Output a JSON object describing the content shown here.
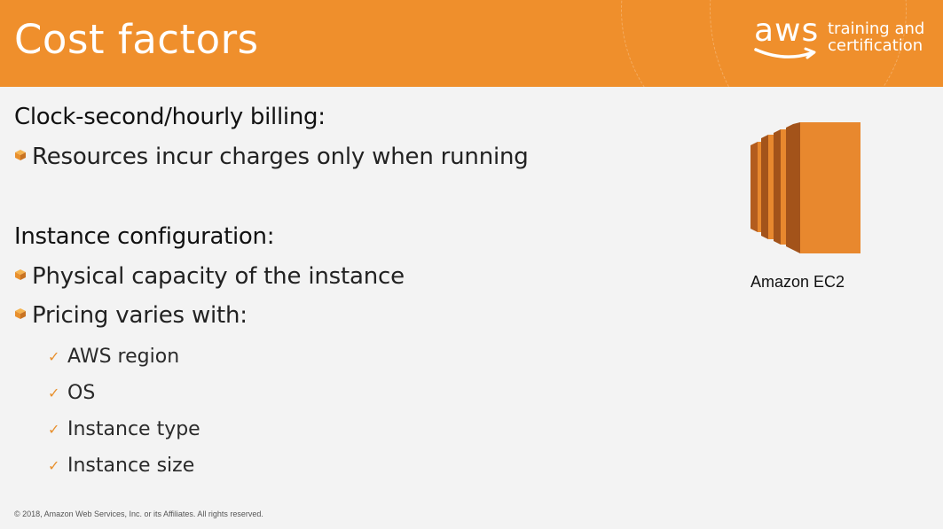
{
  "header": {
    "title": "Cost factors",
    "logo_word": "aws",
    "logo_tagline_1": "training and",
    "logo_tagline_2": "certification"
  },
  "sections": [
    {
      "heading": "Clock-second/hourly billing:",
      "bullets": [
        "Resources incur charges only when running"
      ]
    },
    {
      "heading": "Instance configuration:",
      "bullets": [
        "Physical capacity of the instance",
        "Pricing varies with:"
      ],
      "sub_items": [
        "AWS region",
        "OS",
        "Instance type",
        "Instance size"
      ]
    }
  ],
  "service": {
    "icon": "amazon-ec2-icon",
    "label": "Amazon EC2"
  },
  "footer": "© 2018, Amazon Web Services, Inc. or its Affiliates. All rights reserved.",
  "colors": {
    "header_bg": "#ef8f2c",
    "ec2_orange": "#e8882e",
    "ec2_dark": "#a3531a",
    "bullet_cube": "#f0a030",
    "check": "#e8902e"
  }
}
